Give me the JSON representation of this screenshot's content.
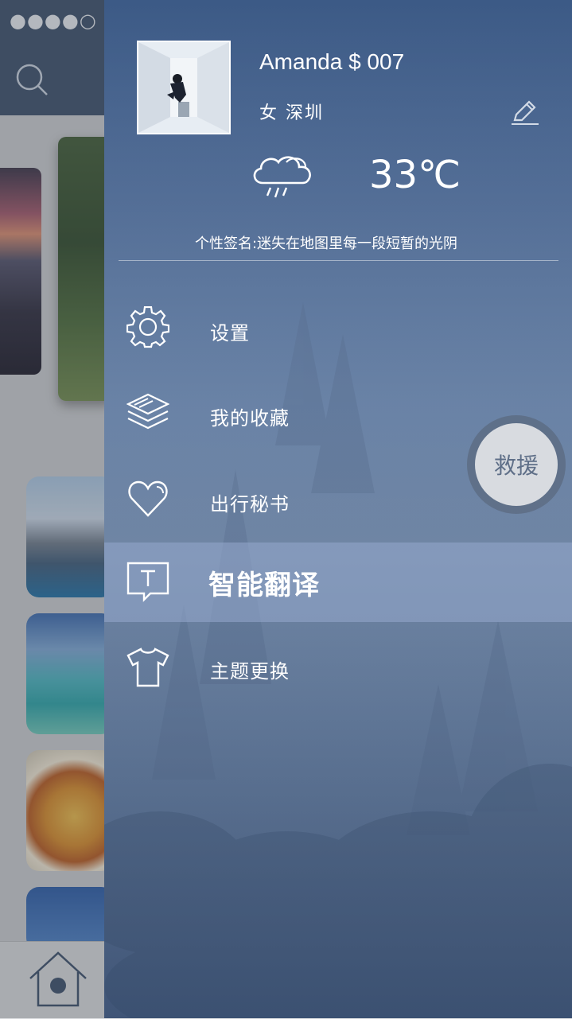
{
  "background_page": {
    "status_text": "●●●●○ Om",
    "icons": [
      "search-icon",
      "home-icon"
    ]
  },
  "drawer": {
    "profile": {
      "name": "Amanda $ 007",
      "gender_city": "女  深圳",
      "edit_icon": "pencil-icon"
    },
    "weather": {
      "icon": "cloud-rain-icon",
      "temperature": "33℃"
    },
    "signature": {
      "label": "个性签名:",
      "text": "迷失在地图里每一段短暂的光阴"
    },
    "menu": [
      {
        "label": "设置",
        "icon": "gear-icon",
        "active": false
      },
      {
        "label": "我的收藏",
        "icon": "layers-icon",
        "active": false
      },
      {
        "label": "出行秘书",
        "icon": "heart-icon",
        "active": false
      },
      {
        "label": "智能翻译",
        "icon": "translate-t-icon",
        "active": true
      },
      {
        "label": "主题更换",
        "icon": "tshirt-icon",
        "active": false
      }
    ],
    "rescue_button": {
      "label": "救援"
    }
  },
  "colors": {
    "drawer_top": "#3c5a86",
    "drawer_mid": "#6c84a5",
    "active_row": "#96aacd",
    "text": "#ffffff",
    "rescue_text": "#5f6f88"
  }
}
